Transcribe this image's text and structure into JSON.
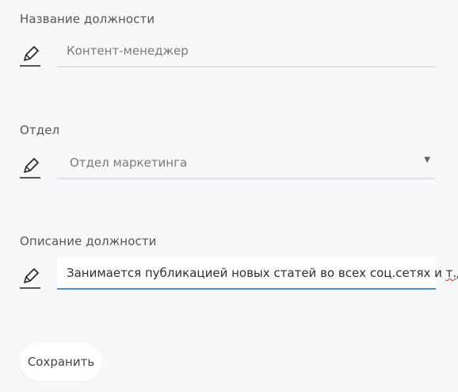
{
  "fields": [
    {
      "label": "Название должности",
      "value": "Контент-менеджер"
    },
    {
      "label": "Отдел",
      "value": "Отдел маркетинга"
    },
    {
      "label": "Описание должности",
      "value_main": "Занимается публикацией новых статей во всех соц.сетях и ",
      "value_flagged": "т.д"
    }
  ],
  "icons": {
    "edit": "pencil-icon",
    "dropdown": "triangle-down"
  },
  "colors": {
    "focus_border": "#4a90d9",
    "spellcheck": "#e0301e"
  },
  "save_label": "Сохранить"
}
